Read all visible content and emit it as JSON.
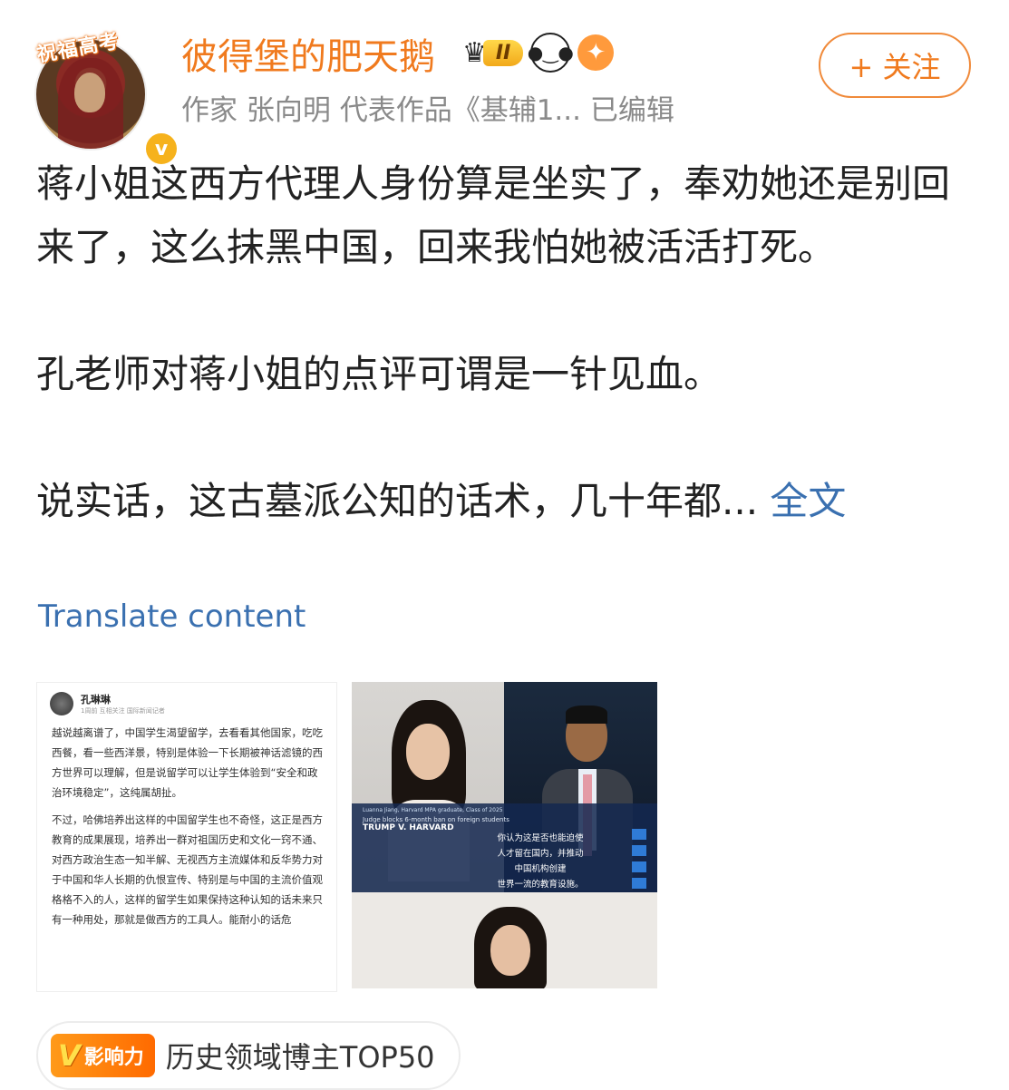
{
  "header": {
    "avatar_banner": "祝福高考",
    "verified_mark": "v",
    "username": "彼得堡的肥天鹅",
    "level_badge": "II",
    "bio": "作家 张向明 代表作品《基辅1...  已编辑",
    "follow_label": "+ 关注",
    "colors": {
      "username": "#f07a1e",
      "accent": "#f07a1e",
      "link": "#3a70b0"
    },
    "icons": [
      "crown-icon",
      "panda-icon",
      "fish-icon"
    ]
  },
  "post": {
    "paragraph1": "蒋小姐这西方代理人身份算是坐实了，奉劝她还是别回来了，这么抹黑中国，回来我怕她被活活打死。",
    "paragraph2": "孔老师对蒋小姐的点评可谓是一针见血。",
    "paragraph3": "说实话，这古墓派公知的话术，几十年都...",
    "more_label": "全文",
    "translate_label": "Translate content"
  },
  "image1": {
    "author": "孔琳琳",
    "meta": "1周前  互相关注  国际新闻记者",
    "para1": "越说越离谱了，中国学生渴望留学，去看看其他国家，吃吃西餐，看一些西洋景，特别是体验一下长期被神话滤镜的西方世界可以理解，但是说留学可以让学生体验到“安全和政治环境稳定”，这纯属胡扯。",
    "para2": "不过，哈佛培养出这样的中国留学生也不奇怪，这正是西方教育的成果展现，培养出一群对祖国历史和文化一窍不通、对西方政治生态一知半解、无视西方主流媒体和反华势力对于中国和华人长期的仇恨宣传、特别是与中国的主流价值观格格不入的人，这样的留学生如果保持这种认知的话未来只有一种用处，那就是做西方的工具人。能耐小的话危"
  },
  "image2": {
    "caption_name": "Luanna Jiang, Harvard MPA graduate, Class of 2025",
    "caption_sub": "Judge blocks 6-month ban on foreign students",
    "caption_title": "TRUMP V. HARVARD",
    "subtitle_lines": [
      "你认为这是否也能迫使",
      "人才留在国内，并推动",
      "中国机构创建",
      "世界一流的教育设施。"
    ]
  },
  "footer": {
    "badge_v": "V",
    "badge_text": "影响力",
    "label": "历史领域博主TOP50"
  }
}
